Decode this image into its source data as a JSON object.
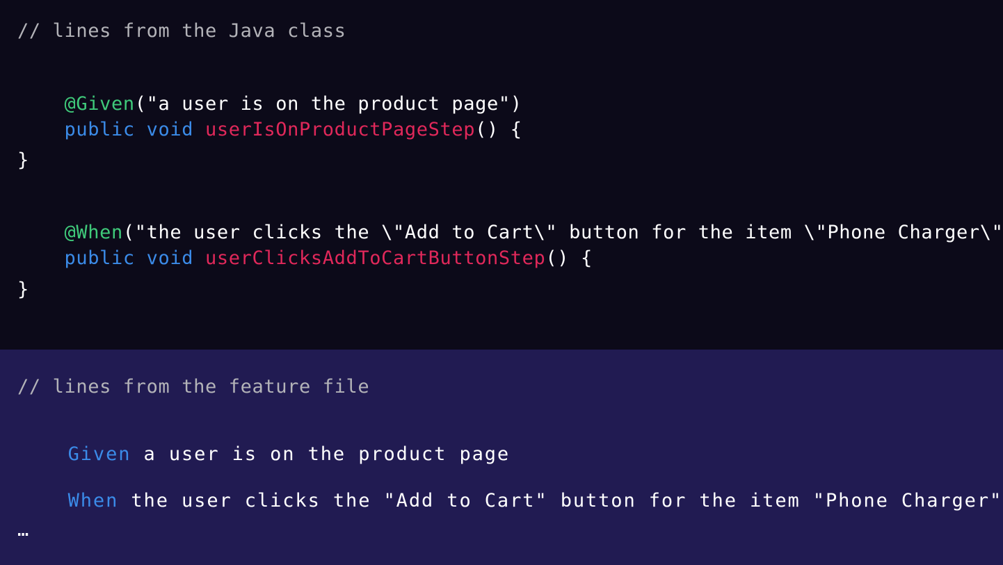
{
  "java_section": {
    "comment": "// lines from the Java class",
    "given_annotation": "@Given",
    "given_text": "(\"a user is on the product page\")",
    "method1_modifiers": "public void ",
    "method1_name": "userIsOnProductPageStep",
    "method1_tail": "() {",
    "method1_close": "}",
    "when_annotation": "@When",
    "when_text": "(\"the user clicks the \\\"Add to Cart\\\" button for the item \\\"Phone Charger\\\"\")",
    "method2_modifiers": "public void ",
    "method2_name": "userClicksAddToCartButtonStep",
    "method2_tail": "() {",
    "method2_close": "}"
  },
  "feature_section": {
    "comment": "// lines from the feature file",
    "given_keyword": "Given",
    "given_text": " a user is on the product page",
    "when_keyword": "When",
    "when_text": " the user clicks the \"Add to Cart\" button for the item \"Phone Charger\"",
    "ellipsis": "…"
  },
  "colors": {
    "java_background": "#0c0a19",
    "feature_background": "#211b52",
    "comment": "#b3b3b8",
    "annotation": "#3fc97a",
    "keyword": "#3b8be8",
    "method_name": "#e0285a",
    "text": "#ffffff"
  }
}
